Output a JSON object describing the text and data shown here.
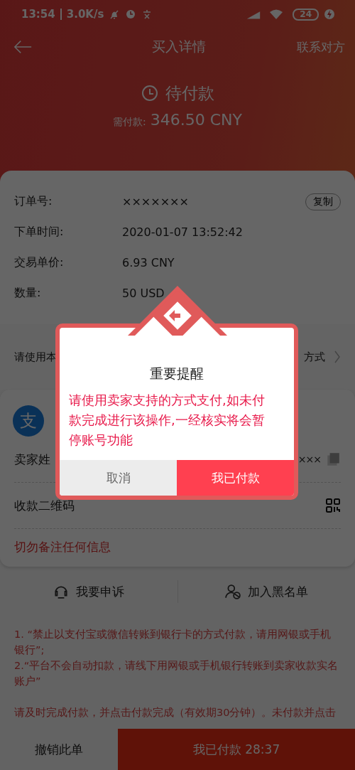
{
  "status_bar": {
    "time": "13:54",
    "net_speed": "3.0K/s",
    "battery": "24"
  },
  "nav": {
    "title": "买入详情",
    "action": "联系对方"
  },
  "status": {
    "label": "待付款",
    "amount_label": "需付款:",
    "amount": "346.50 CNY"
  },
  "order_rows": [
    {
      "label": "订单号:",
      "value": "×××××××",
      "button": "复制"
    },
    {
      "label": "下单时间:",
      "value": "2020-01-07 13:52:42"
    },
    {
      "label": "交易单价:",
      "value": "6.93 CNY"
    },
    {
      "label": "数量:",
      "value": "50 USD"
    }
  ],
  "payment_method": {
    "label": "请使用本",
    "value": "方式"
  },
  "seller": {
    "icon_text": "支",
    "rows": [
      {
        "kind": "copy",
        "label": "卖家姓",
        "value": "×××"
      },
      {
        "kind": "qr",
        "label": "收款二维码"
      }
    ],
    "warning": "切勿备注任何信息"
  },
  "actions": [
    {
      "kind": "appeal",
      "label": "我要申诉"
    },
    {
      "kind": "blacklist",
      "label": "加入黑名单"
    }
  ],
  "notes": [
    "1. “禁止以支付宝或微信转账到银行卡的方式付款，请用网银或手机银行”;",
    "2.“平台不会自动扣款，请线下用网银或手机银行转账到卖家收款实名账户”"
  ],
  "notice": "请及时完成付款，并点击付款完成（有效期30分钟）。未付款并点击",
  "bottom_bar": {
    "cancel": "撤销此单",
    "pay": "我已付款 28:37"
  },
  "dialog": {
    "title": "重要提醒",
    "message": "请使用卖家支持的方式支付,如未付款完成进行该操作,一经核实将会暂停账号功能",
    "cancel": "取消",
    "confirm": "我已付款"
  }
}
